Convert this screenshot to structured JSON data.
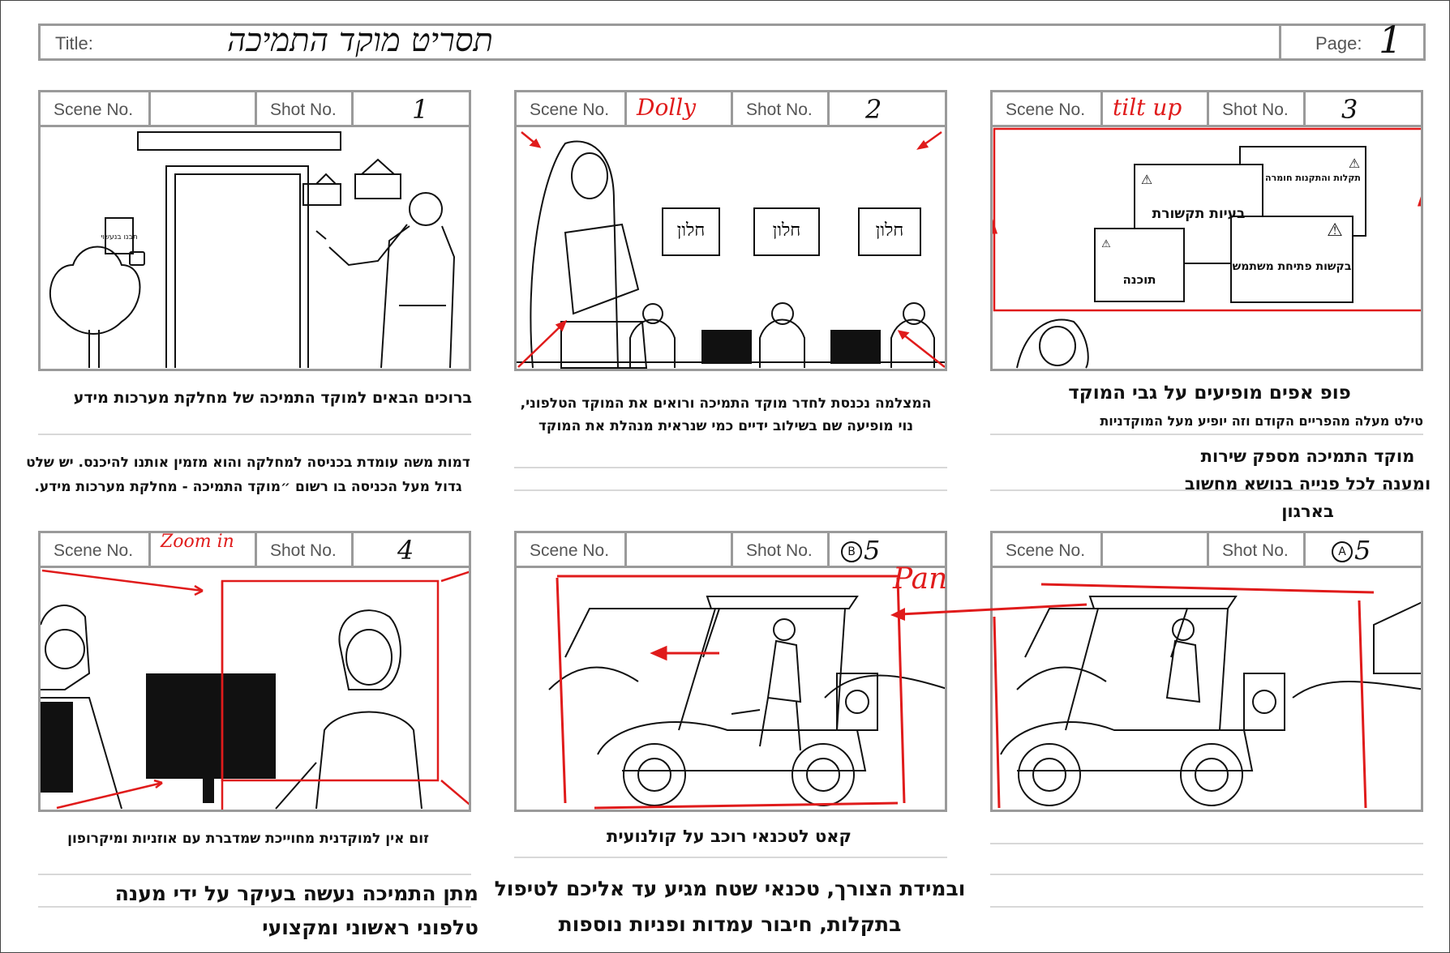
{
  "header": {
    "title_label": "Title:",
    "title_value": "תסריט מוקד התמיכה",
    "page_label": "Page:",
    "page_value": "1"
  },
  "labels": {
    "scene": "Scene No.",
    "shot": "Shot No."
  },
  "panels": [
    {
      "scene_note": "",
      "shot": "1",
      "caption_main": "ברוכים הבאים למוקד התמיכה של מחלקת מערכות מידע",
      "caption_sub": "דמות משה עומדת בכניסה למחלקה והוא מזמין אותנו להיכנס. יש שלט גדול מעל הכניסה בו רשום ״מוקד התמיכה - מחלקת מערכות מידע.",
      "sign_text": "תבנו בנעשוי"
    },
    {
      "scene_note": "Dolly",
      "shot": "2",
      "caption_main": "המצלמה נכנסת לחדר מוקד התמיכה ורואים את המוקד הטלפוני, נוי מופיעה שם בשילוב ידיים כמי שנראית מנהלת את המוקד",
      "window_labels": [
        "חלון",
        "חלון",
        "חלון"
      ]
    },
    {
      "scene_note": "tilt up",
      "shot": "3",
      "caption_title": "פופ אפים מופיעים על גבי המוקד",
      "caption_note": "טילט מעלה מהפריים הקודם וזה יופיע מעל המוקדניות",
      "caption_main": "מוקד התמיכה מספק שירות ומענה לכל פנייה בנושא מחשוב בארגון",
      "popups": [
        "בעיות תקשורת",
        "תקלות והתקנות חומרה",
        "תוכנה",
        "בקשות פתיחת משתמש"
      ]
    },
    {
      "scene_note": "Zoom in",
      "shot": "4",
      "caption_main": "זום אין למוקדנית מחוייכת שמדברת עם אוזניות ומיקרופון",
      "caption_big": "מתן התמיכה נעשה בעיקר על ידי מענה טלפוני ראשוני ומקצועי"
    },
    {
      "scene_note": "",
      "shot": "5",
      "shot_marker": "B",
      "caption_main": "קאט לטכנאי רוכב על קולנועית",
      "caption_big": "ובמידת הצורך, טכנאי שטח מגיע עד אליכם לטיפול בתקלות, חיבור עמדות ופניות נוספות"
    },
    {
      "scene_note": "",
      "shot": "5",
      "shot_marker": "A",
      "pan_label": "Pan"
    }
  ],
  "colors": {
    "red": "#e01b1b",
    "grid": "#9a9a9a",
    "rule": "#d8d8d8"
  }
}
